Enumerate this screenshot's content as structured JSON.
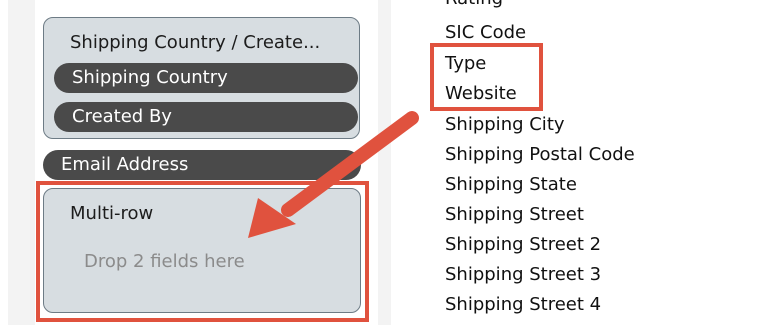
{
  "left": {
    "group": {
      "title": "Shipping Country / Create...",
      "fields": [
        "Shipping Country",
        "Created By"
      ]
    },
    "email_field": "Email Address",
    "multi_row": {
      "title": "Multi-row",
      "hint": "Drop 2 fields here"
    }
  },
  "right": {
    "fields": [
      "Rating",
      "SIC Code",
      "Type",
      "Website",
      "Shipping City",
      "Shipping Postal Code",
      "Shipping State",
      "Shipping Street",
      "Shipping Street 2",
      "Shipping Street 3",
      "Shipping Street 4"
    ]
  },
  "colors": {
    "highlight": "#e0523e",
    "pill": "#4a4a4a",
    "box": "#d7dde1"
  }
}
